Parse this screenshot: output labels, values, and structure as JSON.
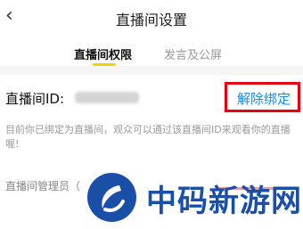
{
  "header": {
    "title": "直播间设置",
    "back_icon": "‹"
  },
  "tabs": [
    {
      "label": "直播间权限",
      "active": true
    },
    {
      "label": "发言及公屏",
      "active": false
    }
  ],
  "live_room": {
    "id_label": "直播间ID:",
    "unbind_label": "解除绑定",
    "description": "目前你已绑定为直播间，观众可以通过该直播间ID来观看你的直播喔!",
    "admin_label": "直播间管理员（"
  },
  "watermark": {
    "text": "中码新游网"
  },
  "colors": {
    "accent_yellow": "#f7d200",
    "link_blue": "#1e88e5",
    "highlight_red": "#e60012",
    "watermark_blue": "#1a4fa8"
  }
}
